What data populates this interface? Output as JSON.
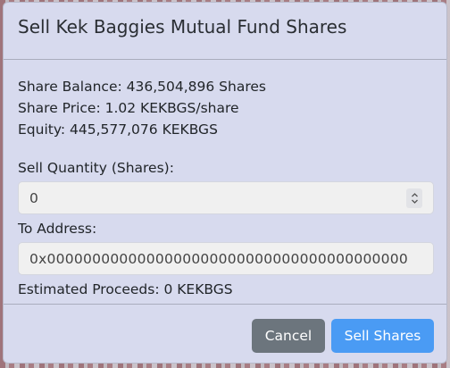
{
  "modal": {
    "title": "Sell Kek Baggies Mutual Fund Shares",
    "share_balance": "Share Balance: 436,504,896 Shares",
    "share_price": "Share Price: 1.02 KEKBGS/share",
    "equity": "Equity: 445,577,076 KEKBGS",
    "sell_quantity_label": "Sell Quantity (Shares):",
    "sell_quantity_value": "0",
    "to_address_label": "To Address:",
    "to_address_value": "0x0000000000000000000000000000000000000000",
    "estimated_proceeds": "Estimated Proceeds: 0 KEKBGS",
    "cancel_label": "Cancel",
    "sell_label": "Sell Shares"
  },
  "colors": {
    "modal_bg": "#d7daee",
    "cancel_button": "#6c757d",
    "sell_button": "#4a9bf4"
  },
  "icons": {
    "stepper": "up-down-chevron-icon"
  }
}
